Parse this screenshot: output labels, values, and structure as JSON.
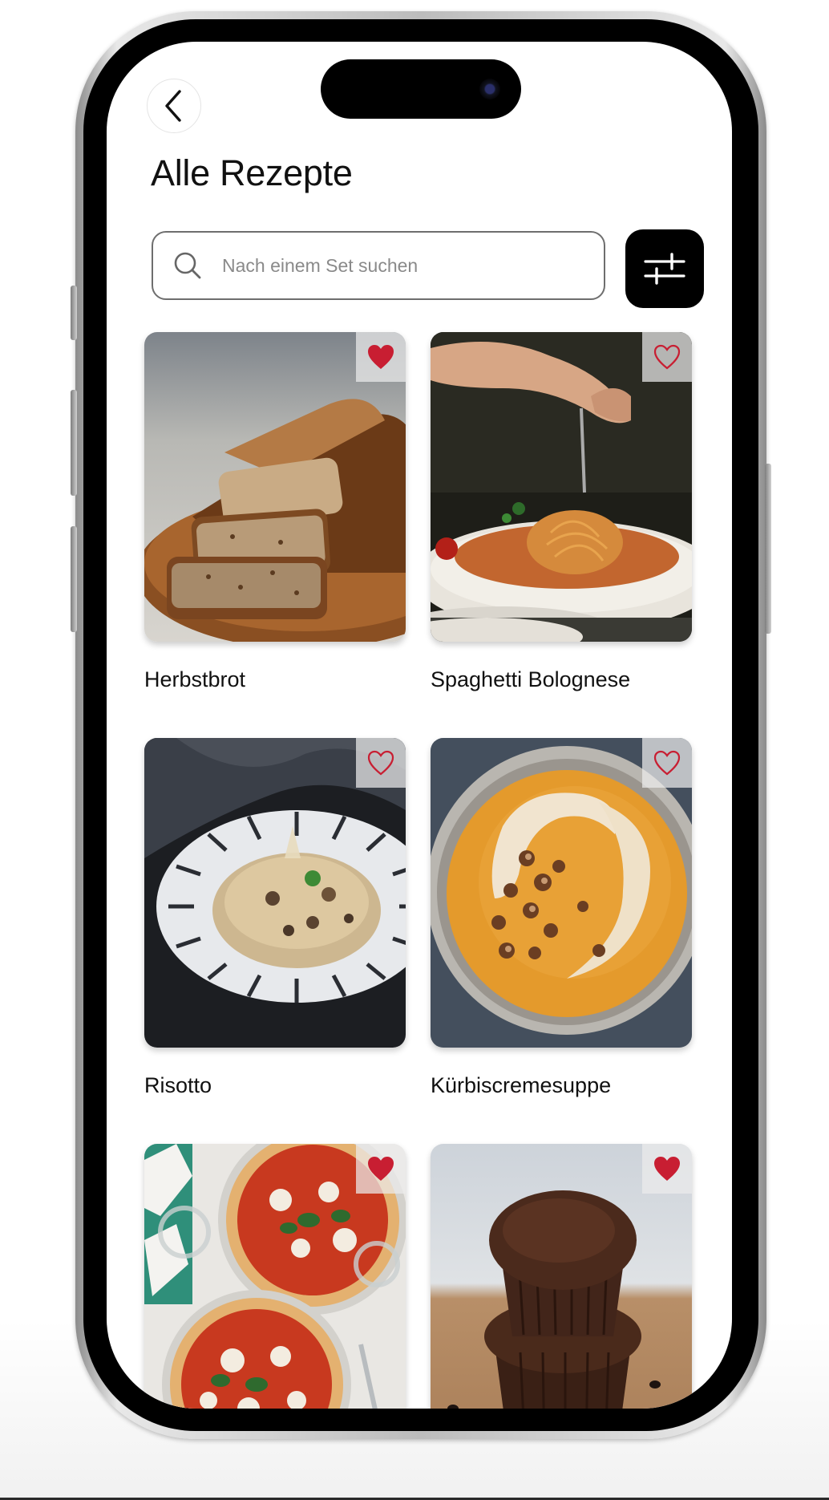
{
  "header": {
    "title": "Alle Rezepte",
    "back_icon": "chevron-left-icon"
  },
  "search": {
    "placeholder": "Nach einem Set suchen",
    "value": "",
    "icon": "search-icon"
  },
  "filter": {
    "icon": "sliders-icon"
  },
  "recipes": [
    {
      "name": "Herbstbrot",
      "favorite": true
    },
    {
      "name": "Spaghetti Bolognese",
      "favorite": false
    },
    {
      "name": "Risotto",
      "favorite": false
    },
    {
      "name": "Kürbiscremesuppe",
      "favorite": false
    },
    {
      "name": "",
      "favorite": true
    },
    {
      "name": "",
      "favorite": true
    }
  ],
  "colors": {
    "accent_heart": "#c81e32",
    "filter_button": "#000000",
    "text": "#111111"
  }
}
